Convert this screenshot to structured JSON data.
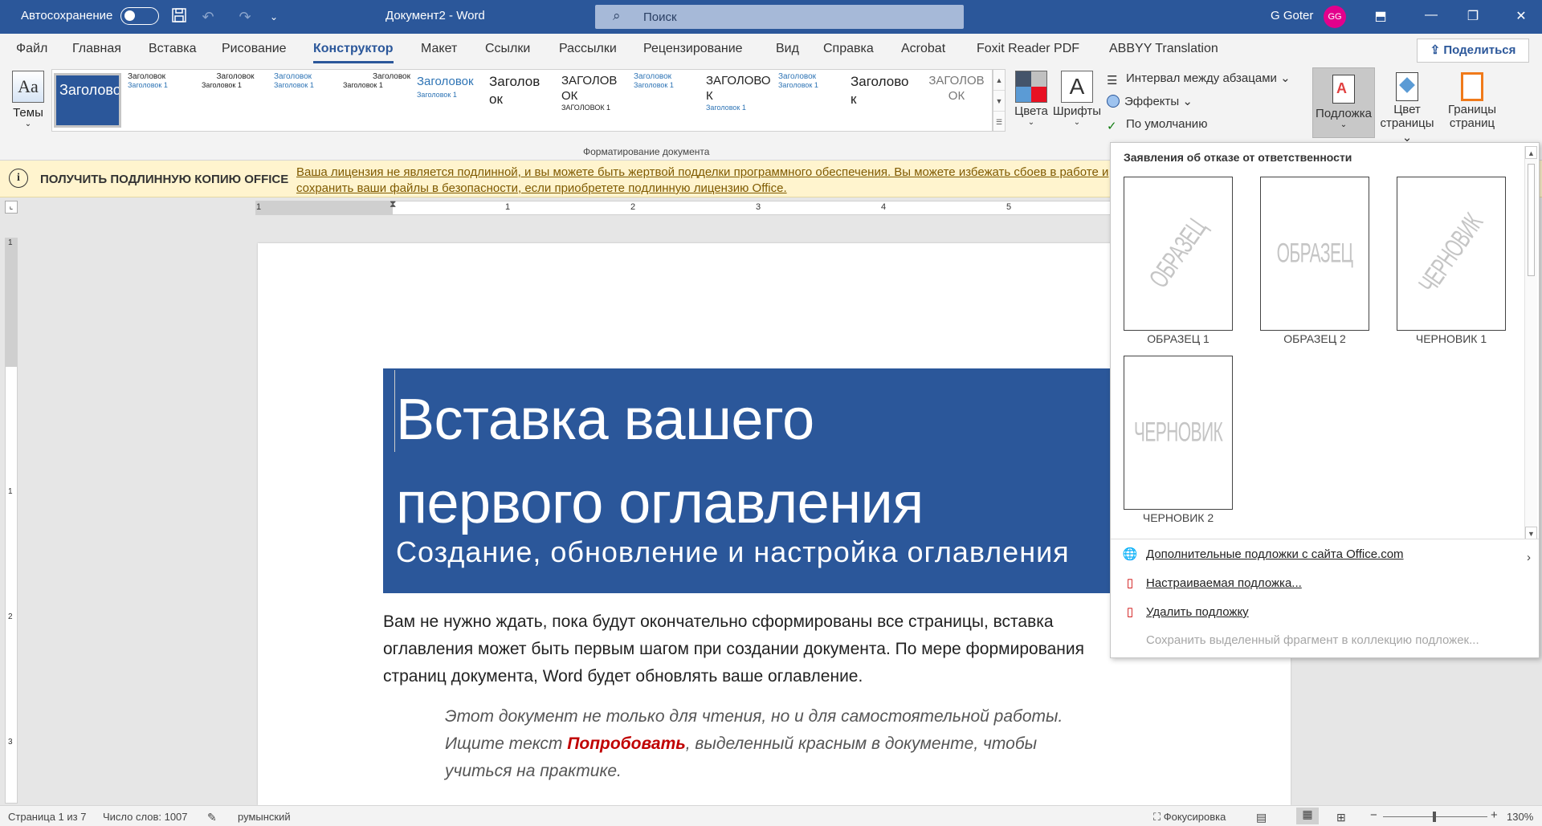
{
  "titlebar": {
    "autosave_label": "Автосохранение",
    "doc_title": "Документ2 - Word",
    "search_placeholder": "Поиск",
    "user_name": "G Goter",
    "user_initials": "GG"
  },
  "tabs": [
    "Файл",
    "Главная",
    "Вставка",
    "Рисование",
    "Конструктор",
    "Макет",
    "Ссылки",
    "Рассылки",
    "Рецензирование",
    "Вид",
    "Справка",
    "Acrobat",
    "Foxit Reader PDF",
    "ABBYY Translation"
  ],
  "active_tab": "Конструктор",
  "share_label": "Поделиться",
  "ribbon": {
    "themes_label": "Темы",
    "gallery_selected": "Заголовок",
    "gallery_items": [
      {
        "title": "Заголовок",
        "heading": "Заголовок 1"
      },
      {
        "title": "Заголовок",
        "heading": "Заголовок 1"
      },
      {
        "title": "Заголовок",
        "heading": "Заголовок 1"
      },
      {
        "title": "Заголовок",
        "heading": "Заголовок 1"
      },
      {
        "title": "Заголовок",
        "heading": "Заголовок 1"
      },
      {
        "title": "Заголов ок",
        "heading": ""
      },
      {
        "title": "ЗАГОЛОВ ОК",
        "heading": "ЗАГОЛОВОК 1"
      },
      {
        "title": "Заголовок",
        "heading": "Заголовок 1"
      },
      {
        "title": "ЗАГОЛОВО К",
        "heading": "Заголовок 1"
      },
      {
        "title": "Заголовок",
        "heading": "Заголовок 1"
      },
      {
        "title": "Заголово к",
        "heading": ""
      },
      {
        "title": "ЗАГОЛОВ ОК",
        "heading": ""
      }
    ],
    "group_label": "Форматирование документа",
    "colors_label": "Цвета",
    "fonts_label": "Шрифты",
    "paragraph_spacing_label": "Интервал между абзацами",
    "effects_label": "Эффекты",
    "default_label": "По умолчанию",
    "watermark_label": "Подложка",
    "page_color_label_1": "Цвет",
    "page_color_label_2": "страницы",
    "page_borders_label_1": "Границы",
    "page_borders_label_2": "страниц"
  },
  "infobar": {
    "title": "ПОЛУЧИТЬ ПОДЛИННУЮ КОПИЮ OFFICE",
    "message": "Ваша лицензия не является подлинной, и вы можете быть жертвой подделки программного обеспечения. Вы можете избежать сбоев в работе и сохранить ваши файлы в безопасности, если приобретете подлинную лицензию Office."
  },
  "ruler": {
    "h_numbers": [
      "1",
      "1",
      "2",
      "3",
      "4",
      "5"
    ],
    "v_numbers": [
      "1",
      "1",
      "2",
      "3"
    ]
  },
  "document": {
    "title_line1": "Вставка вашего",
    "title_line2": "первого оглавления",
    "subtitle": "Создание, обновление и настройка оглавления",
    "paragraph": "Вам не нужно ждать, пока будут окончательно сформированы все страницы, вставка оглавления может быть первым шагом при создании документа. По мере формирования страниц документа, Word будет обновлять ваше оглавление.",
    "italic_before": "Этот документ не только для чтения, но и для самостоятельной работы. Ищите текст ",
    "italic_red": "Попробовать",
    "italic_after": ", выделенный красным в документе, чтобы учиться на практике."
  },
  "watermark_menu": {
    "header": "Заявления об отказе от ответственности",
    "items": [
      {
        "caption": "ОБРАЗЕЦ 1",
        "text": "ОБРАЗЕЦ"
      },
      {
        "caption": "ОБРАЗЕЦ 2",
        "text": "ОБРАЗЕЦ"
      },
      {
        "caption": "ЧЕРНОВИК 1",
        "text": "ЧЕРНОВИК"
      },
      {
        "caption": "ЧЕРНОВИК 2",
        "text": "ЧЕРНОВИК"
      }
    ],
    "more_online": "Дополнительные подложки с сайта Office.com",
    "custom": "Настраиваемая подложка...",
    "remove": "Удалить подложку",
    "save_selection": "Сохранить выделенный фрагмент в коллекцию подложек..."
  },
  "statusbar": {
    "page": "Страница 1 из 7",
    "words": "Число слов: 1007",
    "language": "румынский",
    "focus": "Фокусировка",
    "zoom_level": "130%",
    "zoom_minus": "−",
    "zoom_plus": "+"
  },
  "colors": {
    "brand": "#2b579a",
    "info_bg": "#fff4ce",
    "avatar": "#e3008c",
    "try_red": "#c00000"
  }
}
